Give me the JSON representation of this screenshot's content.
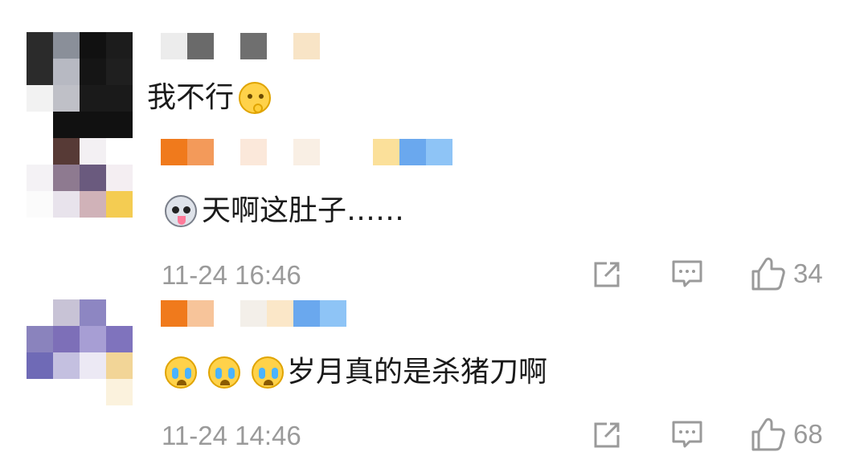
{
  "comments": [
    {
      "text": "我不行",
      "emoji_before": [],
      "emoji_after": [
        "thinking-face-icon"
      ],
      "name_colors": [
        "#ececec",
        "#6a6a6a",
        "#ffffff",
        "#6f6f6f",
        "#ffffff",
        "#f8e4c6"
      ],
      "avatar_colors": [
        "#2b2b2b",
        "#8a8f99",
        "#111111",
        "#b7b9c2",
        "#1c1c1c",
        "#111111"
      ]
    },
    {
      "text": "天啊这肚子……",
      "emoji_before": [
        "husky-dog-icon"
      ],
      "emoji_after": [],
      "time": "11-24 16:46",
      "likes": "34",
      "name_colors": [
        "#f07a1c",
        "#f39a5a",
        "#ffffff",
        "#fbe8da",
        "#ffffff",
        "#f9efe4",
        "#fbe09a",
        "#6aa8ee",
        "#8ec4f6"
      ],
      "avatar_colors": [
        "#573a36",
        "#d7d3d9",
        "#8e7a90",
        "#6a5a7e",
        "#e8e3ec",
        "#d0b2b8",
        "#f4cc52"
      ]
    },
    {
      "text": "岁月真的是杀猪刀啊",
      "emoji_before": [
        "crying-face-icon",
        "crying-face-icon",
        "crying-face-icon"
      ],
      "emoji_after": [],
      "time": "11-24 14:46",
      "likes": "68",
      "name_colors": [
        "#f07a1c",
        "#f7c49a",
        "#ffffff",
        "#f3efe9",
        "#fbe7c8",
        "#6aa8ee",
        "#8ec4f6"
      ],
      "avatar_colors": [
        "#c8c3d6",
        "#8d86c2",
        "#8a83bd",
        "#7d6fb8",
        "#a79ed4",
        "#7f73bd",
        "#6f6ab6",
        "#c4c0e0",
        "#f2d597"
      ]
    }
  ]
}
